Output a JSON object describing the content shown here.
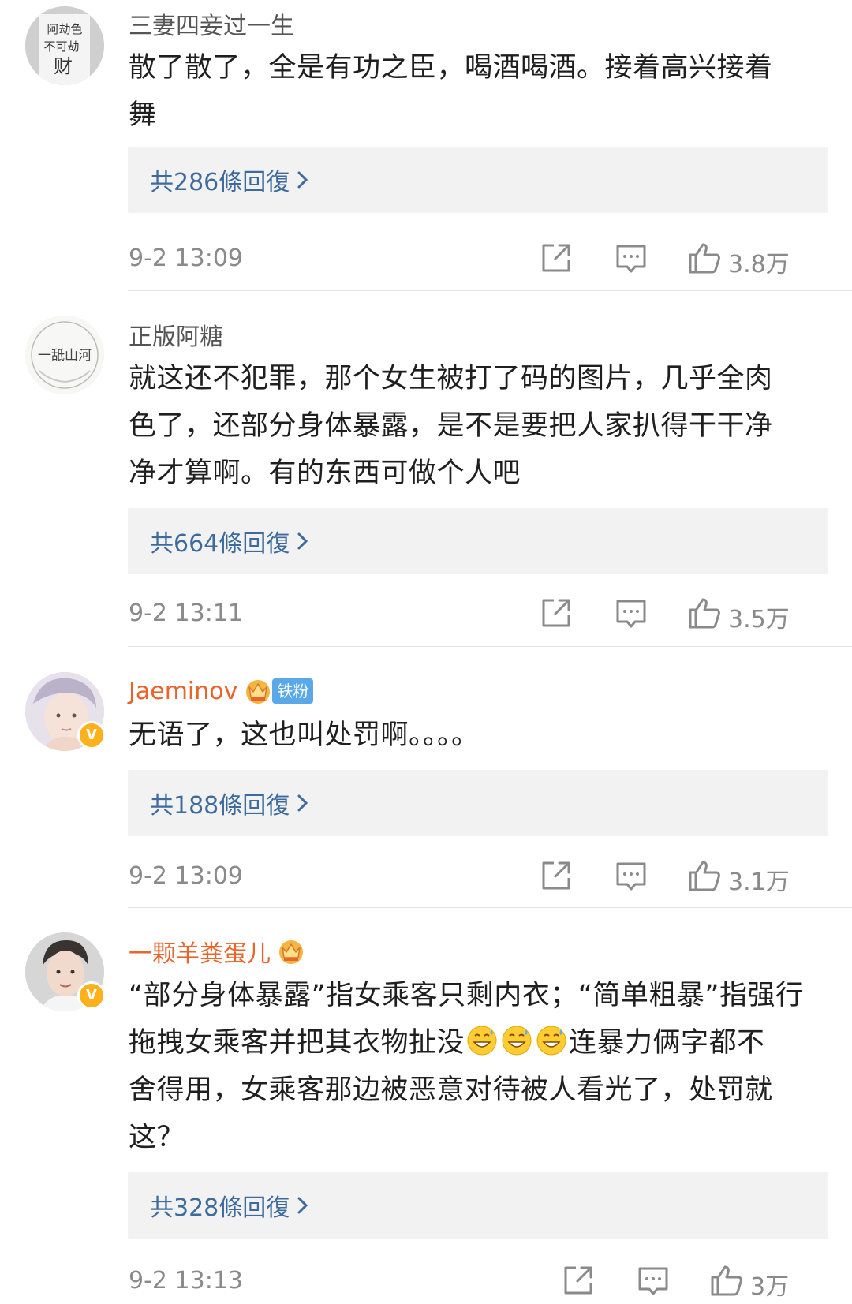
{
  "comments": [
    {
      "username": "三妻四妾过一生",
      "avatar_text": [
        "阿劫色",
        "不可劫",
        "财"
      ],
      "lines": [
        "散了散了，全是有功之臣，喝酒喝酒。接着高兴接着",
        "舞"
      ],
      "replies": "共286條回復",
      "time": "9-2 13:09",
      "likes": "3.8万"
    },
    {
      "username": "正版阿糖",
      "avatar_text": [
        "一舐山河"
      ],
      "lines": [
        "就这还不犯罪，那个女生被打了码的图片，几乎全肉",
        "色了，还部分身体暴露，是不是要把人家扒得干干净",
        "净才算啊。有的东西可做个人吧"
      ],
      "replies": "共664條回復",
      "time": "9-2 13:11",
      "likes": "3.5万"
    },
    {
      "username": "Jaeminov",
      "fan_badge": "铁粉",
      "verified_mark": "V",
      "lines": [
        "无语了，这也叫处罚啊。。。。"
      ],
      "replies": "共188條回復",
      "time": "9-2 13:09",
      "likes": "3.1万"
    },
    {
      "username": "一颗羊粪蛋儿",
      "verified_mark": "V",
      "lines_rich": [
        [
          "“部分身体暴露”指女乘客只剩内衣；“简单粗暴”指强行"
        ],
        [
          "拖拽女乘客并把其衣物扯没",
          "连暴力俩字都不"
        ],
        [
          "舍得用，女乘客那边被恶意对待被人看光了，处罚就"
        ],
        [
          "这？"
        ]
      ],
      "emoji_icon": "grinning-sweat-emoji",
      "replies": "共328條回復",
      "time": "9-2 13:13",
      "likes": "3万"
    }
  ],
  "colors": {
    "vip_name": "#e8642b",
    "reply_link": "#3d6b9d",
    "reply_bg": "#f2f2f2",
    "meta_text": "#8a8a8a",
    "verified": "#ffb11b",
    "fan_badge": "#5aa8e8"
  },
  "icons": [
    "share-icon",
    "comment-icon",
    "like-icon",
    "crown-icon",
    "chevron-right-icon"
  ]
}
